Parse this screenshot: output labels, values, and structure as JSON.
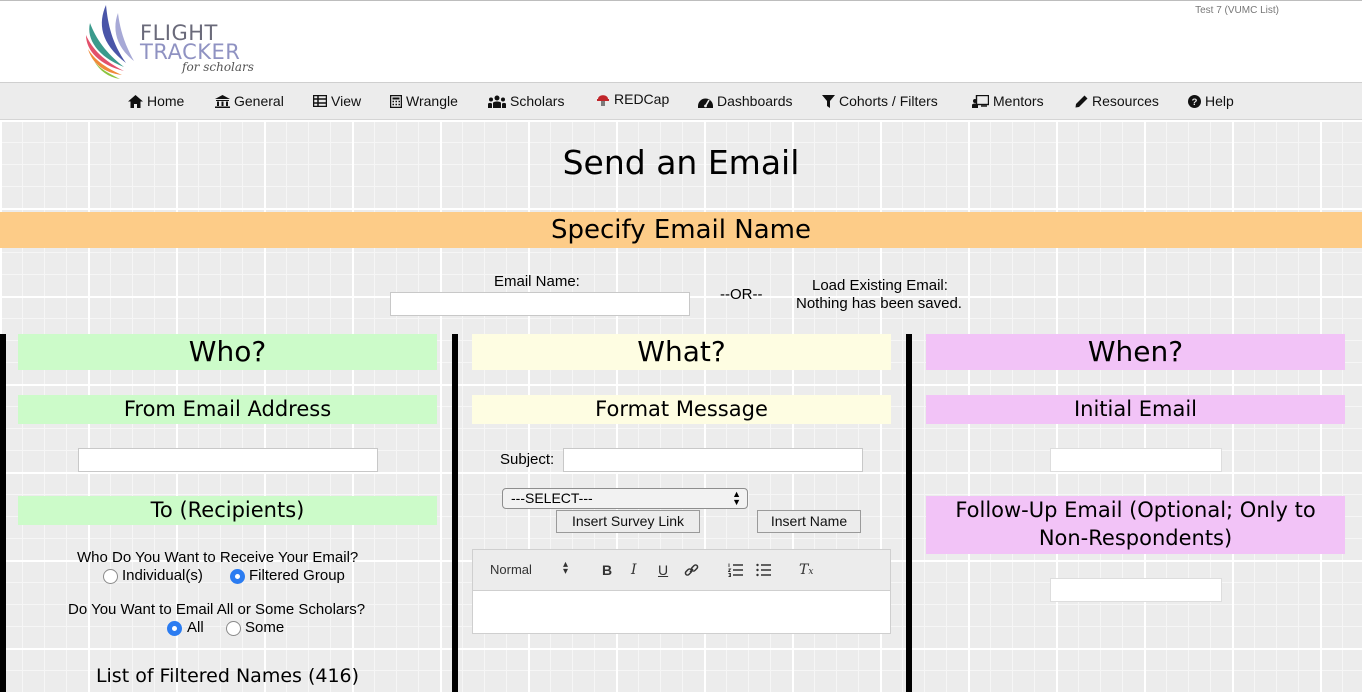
{
  "header": {
    "logo": {
      "line1": "FLIGHT",
      "line2": "TRACKER",
      "line3": "for scholars"
    },
    "project_label": "Test 7 (VUMC List)"
  },
  "nav": [
    {
      "label": "Home",
      "icon": "home-icon"
    },
    {
      "label": "General",
      "icon": "bank-icon"
    },
    {
      "label": "View",
      "icon": "table-icon"
    },
    {
      "label": "Wrangle",
      "icon": "calculator-icon"
    },
    {
      "label": "Scholars",
      "icon": "users-icon"
    },
    {
      "label": "REDCap",
      "icon": "redcap-icon"
    },
    {
      "label": "Dashboards",
      "icon": "tachometer-icon"
    },
    {
      "label": "Cohorts / Filters",
      "icon": "filter-icon"
    },
    {
      "label": "Mentors",
      "icon": "chalkboard-icon"
    },
    {
      "label": "Resources",
      "icon": "pencil-icon"
    },
    {
      "label": "Help",
      "icon": "question-icon"
    }
  ],
  "page_title": "Send an Email",
  "name_section": {
    "banner": "Specify Email Name",
    "email_name_label": "Email Name:",
    "email_name_value": "",
    "or_text": "--OR--",
    "load_label": "Load Existing Email:",
    "load_status": "Nothing has been saved."
  },
  "who": {
    "title": "Who?",
    "from_header": "From Email Address",
    "from_value": "",
    "to_header": "To (Recipients)",
    "q1": "Who Do You Want to Receive Your Email?",
    "q1_options": [
      "Individual(s)",
      "Filtered Group"
    ],
    "q1_selected": "Filtered Group",
    "q2": "Do You Want to Email All or Some Scholars?",
    "q2_options": [
      "All",
      "Some"
    ],
    "q2_selected": "All",
    "list_title": "List of Filtered Names (416)"
  },
  "what": {
    "title": "What?",
    "format_header": "Format Message",
    "subject_label": "Subject:",
    "subject_value": "",
    "select_value": "---SELECT---",
    "insert_survey_link": "Insert Survey Link",
    "insert_name": "Insert Name",
    "editor": {
      "format_value": "Normal",
      "body": ""
    }
  },
  "when": {
    "title": "When?",
    "initial_header": "Initial Email",
    "initial_value": "",
    "followup_header": "Follow-Up Email (Optional; Only to Non-Respondents)",
    "followup_value": ""
  },
  "colors": {
    "banner": "#fdcc88",
    "who": "#ccfbc9",
    "what": "#fefde2",
    "when": "#f2c3f7",
    "radio_selected": "#2b7cf1"
  }
}
